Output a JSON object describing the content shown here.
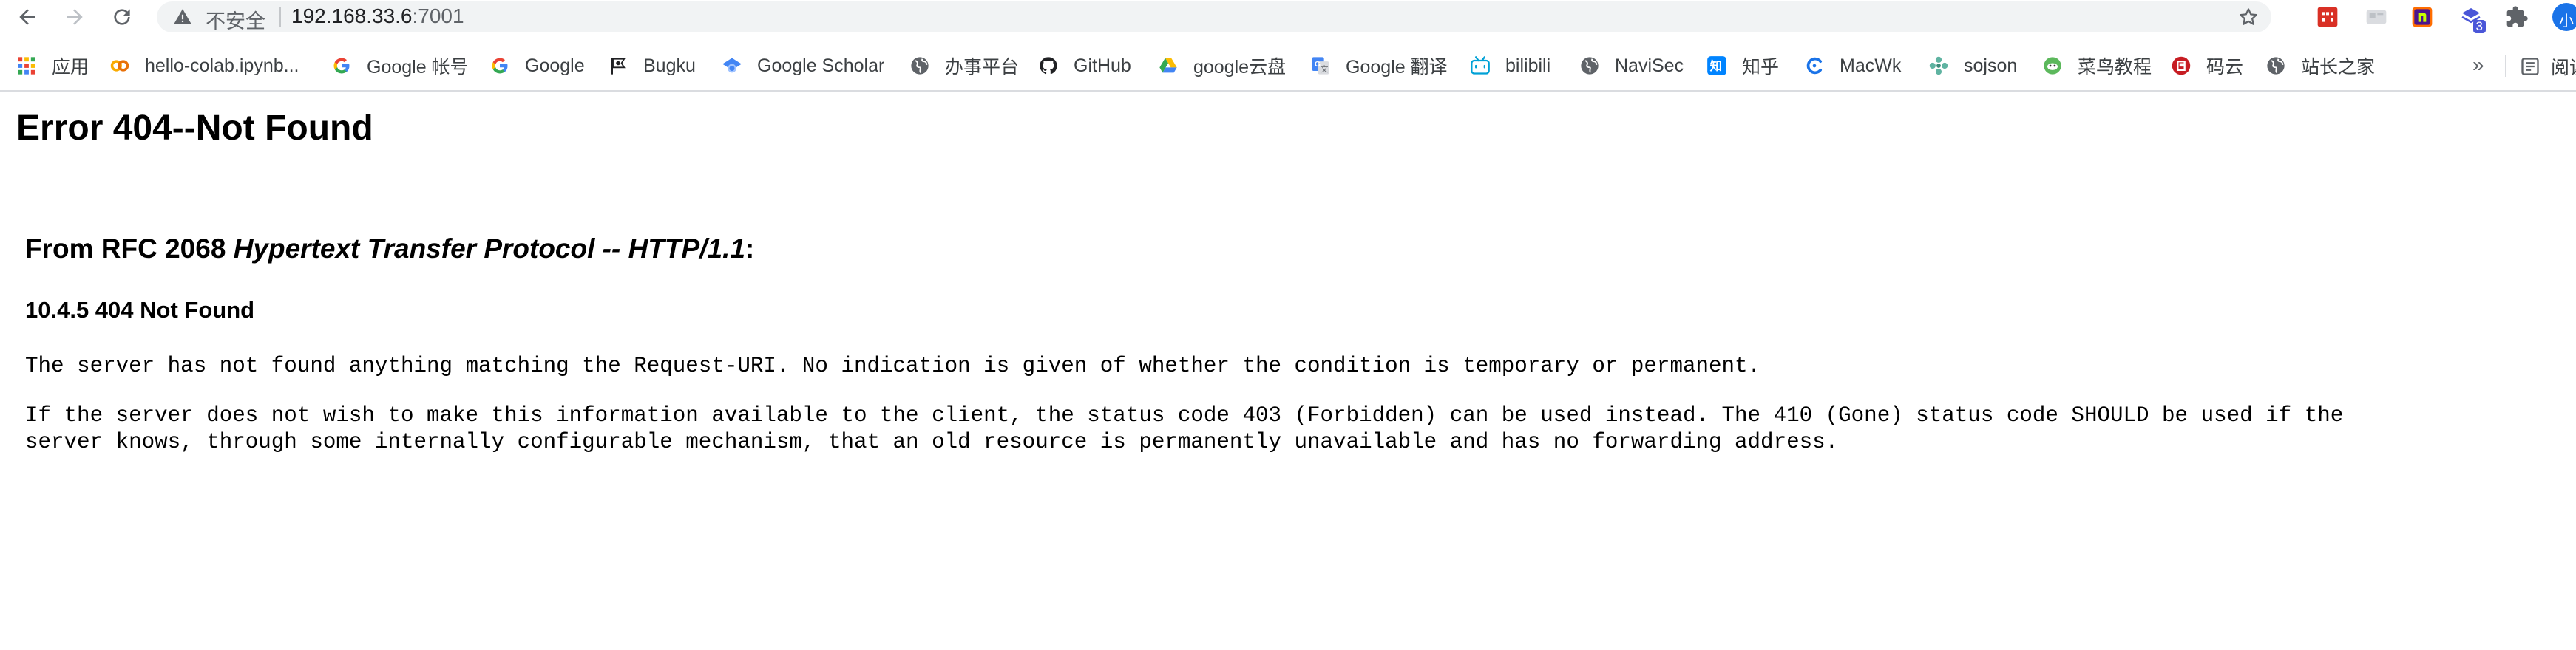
{
  "toolbar": {
    "security_label": "不安全",
    "url_host": "192.168.33.6",
    "url_port": ":7001",
    "extensions": [
      {
        "icon": "red-grid-extension-icon",
        "color": "#d93025"
      },
      {
        "icon": "grey-card-extension-icon",
        "color": "#bdc1c6"
      },
      {
        "icon": "n-logo-extension-icon",
        "color": "#ff6d00"
      },
      {
        "icon": "purple-extension-icon",
        "color": "#4a56d8",
        "badge": "3"
      },
      {
        "icon": "puzzle-icon",
        "color": "#5f6368"
      }
    ],
    "avatar_text": "小"
  },
  "bookmarks": {
    "items": [
      {
        "label": "应用",
        "icon": "apps-grid-icon"
      },
      {
        "label": "hello-colab.ipynb...",
        "icon": "colab-icon"
      },
      {
        "label": "Google 帐号",
        "icon": "google-g-icon"
      },
      {
        "label": "Google",
        "icon": "google-g-icon"
      },
      {
        "label": "Bugku",
        "icon": "bugku-icon"
      },
      {
        "label": "Google Scholar",
        "icon": "scholar-icon"
      },
      {
        "label": "办事平台",
        "icon": "globe-icon"
      },
      {
        "label": "GitHub",
        "icon": "github-icon"
      },
      {
        "label": "google云盘",
        "icon": "drive-icon"
      },
      {
        "label": "Google 翻译",
        "icon": "translate-icon"
      },
      {
        "label": "bilibili",
        "icon": "bilibili-icon"
      },
      {
        "label": "NaviSec",
        "icon": "globe-icon"
      },
      {
        "label": "知乎",
        "icon": "zhihu-icon"
      },
      {
        "label": "MacWk",
        "icon": "macwk-icon"
      },
      {
        "label": "sojson",
        "icon": "sojson-icon"
      },
      {
        "label": "菜鸟教程",
        "icon": "runoob-icon"
      },
      {
        "label": "码云",
        "icon": "gitee-icon"
      },
      {
        "label": "站长之家",
        "icon": "globe-icon"
      }
    ],
    "more_label": "»",
    "reading_list_label": "阅读"
  },
  "page": {
    "title": "Error 404--Not Found",
    "rfc_prefix": "From RFC 2068 ",
    "rfc_title": "Hypertext Transfer Protocol -- HTTP/1.1",
    "rfc_suffix": ":",
    "section_heading": "10.4.5 404 Not Found",
    "paragraph1": "The server has not found anything matching the Request-URI. No indication is given of whether the condition is temporary or permanent.",
    "paragraph2_line1": "If the server does not wish to make this information available to the client, the status code 403 (Forbidden) can be used instead. The 410 (Gone) status code SHOULD be used if the",
    "paragraph2_line2": "server knows, through some internally configurable mechanism, that an old resource is permanently unavailable and has no forwarding address."
  }
}
